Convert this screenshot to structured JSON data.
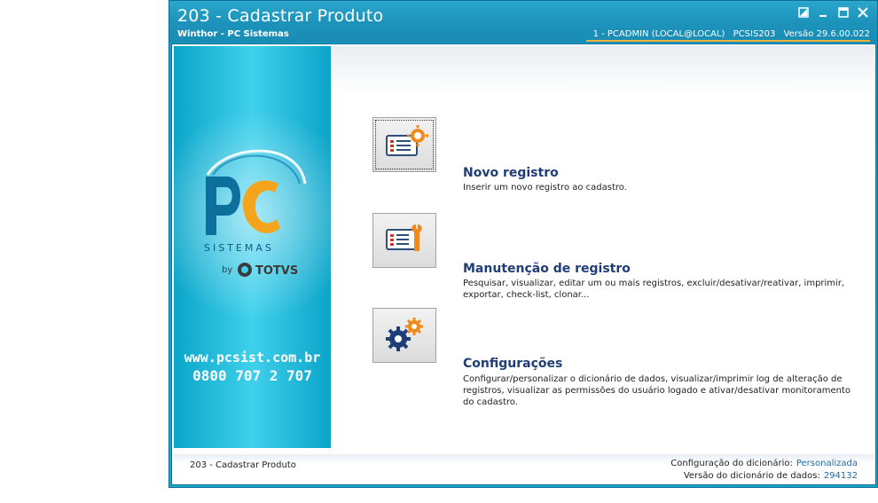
{
  "window": {
    "title": "203 - Cadastrar  Produto",
    "subtitle": "Winthor - PC Sistemas",
    "info_user": "1 - PCADMIN (LOCAL@LOCAL)",
    "info_program": "PCSIS203",
    "info_version": "Versão  29.6.00.022",
    "controls": [
      "restore-icon",
      "minimize-icon",
      "maximize-icon",
      "close-icon"
    ],
    "accent_color": "#1a8cb4",
    "underline_color": "#f0b23a"
  },
  "banner": {
    "logo_letters": "PC",
    "logo_word": "SISTEMAS",
    "logo_by": "by",
    "logo_brand": "TOTVS",
    "website": "www.pcsist.com.br",
    "phone": "0800 707 2 707"
  },
  "options": [
    {
      "title": "Novo registro",
      "description": "Inserir um novo registro ao cadastro.",
      "icon": "new-record-icon"
    },
    {
      "title": "Manutenção de registro",
      "description": "Pesquisar, visualizar, editar um ou mais registros, excluir/desativar/reativar, imprimir, exportar, check-list,  clonar...",
      "icon": "maintenance-icon"
    },
    {
      "title": "Configurações",
      "description": "Configurar/personalizar o dicionário de dados, visualizar/imprimir log de alteração de registros, visualizar as permissões do usuário logado e ativar/desativar monitoramento do cadastro.",
      "icon": "settings-gears-icon"
    }
  ],
  "status": {
    "program": "203 - Cadastrar  Produto",
    "dict_config_label": "Configuração do dicionário:",
    "dict_config_value": "Personalizada",
    "dict_version_label": "Versão do dicionário de dados:",
    "dict_version_value": "294132"
  }
}
